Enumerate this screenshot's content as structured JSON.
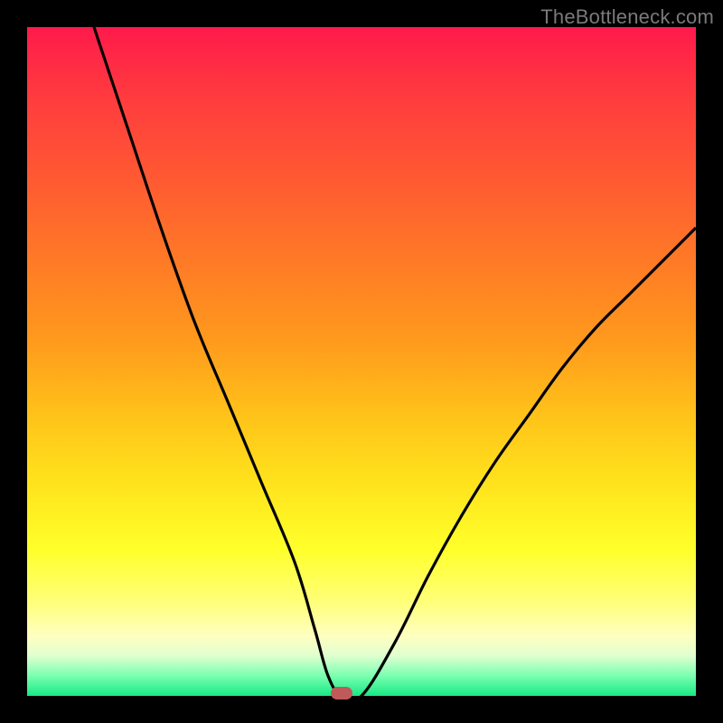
{
  "watermark": "TheBottleneck.com",
  "chart_data": {
    "type": "line",
    "title": "",
    "xlabel": "",
    "ylabel": "",
    "xlim": [
      0,
      100
    ],
    "ylim": [
      0,
      100
    ],
    "grid": false,
    "legend": false,
    "gradient_stops": [
      {
        "pos": 0,
        "color": "#ff1a4b"
      },
      {
        "pos": 10,
        "color": "#ff3a3f"
      },
      {
        "pos": 23,
        "color": "#ff5a32"
      },
      {
        "pos": 35,
        "color": "#ff7a26"
      },
      {
        "pos": 47,
        "color": "#ff9a1c"
      },
      {
        "pos": 58,
        "color": "#ffc21a"
      },
      {
        "pos": 68,
        "color": "#ffe21c"
      },
      {
        "pos": 78,
        "color": "#ffff2a"
      },
      {
        "pos": 86,
        "color": "#ffff7a"
      },
      {
        "pos": 91,
        "color": "#ffffc0"
      },
      {
        "pos": 94,
        "color": "#e0ffd0"
      },
      {
        "pos": 97,
        "color": "#7affb0"
      },
      {
        "pos": 100,
        "color": "#18e884"
      }
    ],
    "series": [
      {
        "name": "bottleneck-curve",
        "color": "#000000",
        "x": [
          10,
          15,
          20,
          25,
          30,
          35,
          40,
          43,
          45,
          47,
          50,
          55,
          60,
          65,
          70,
          75,
          80,
          85,
          90,
          95,
          100
        ],
        "y": [
          100,
          85,
          70,
          56,
          44,
          32,
          20,
          10,
          3,
          0,
          0,
          8,
          18,
          27,
          35,
          42,
          49,
          55,
          60,
          65,
          70
        ]
      }
    ],
    "marker": {
      "x": 47,
      "y": 0,
      "color": "#c05a5a"
    }
  }
}
